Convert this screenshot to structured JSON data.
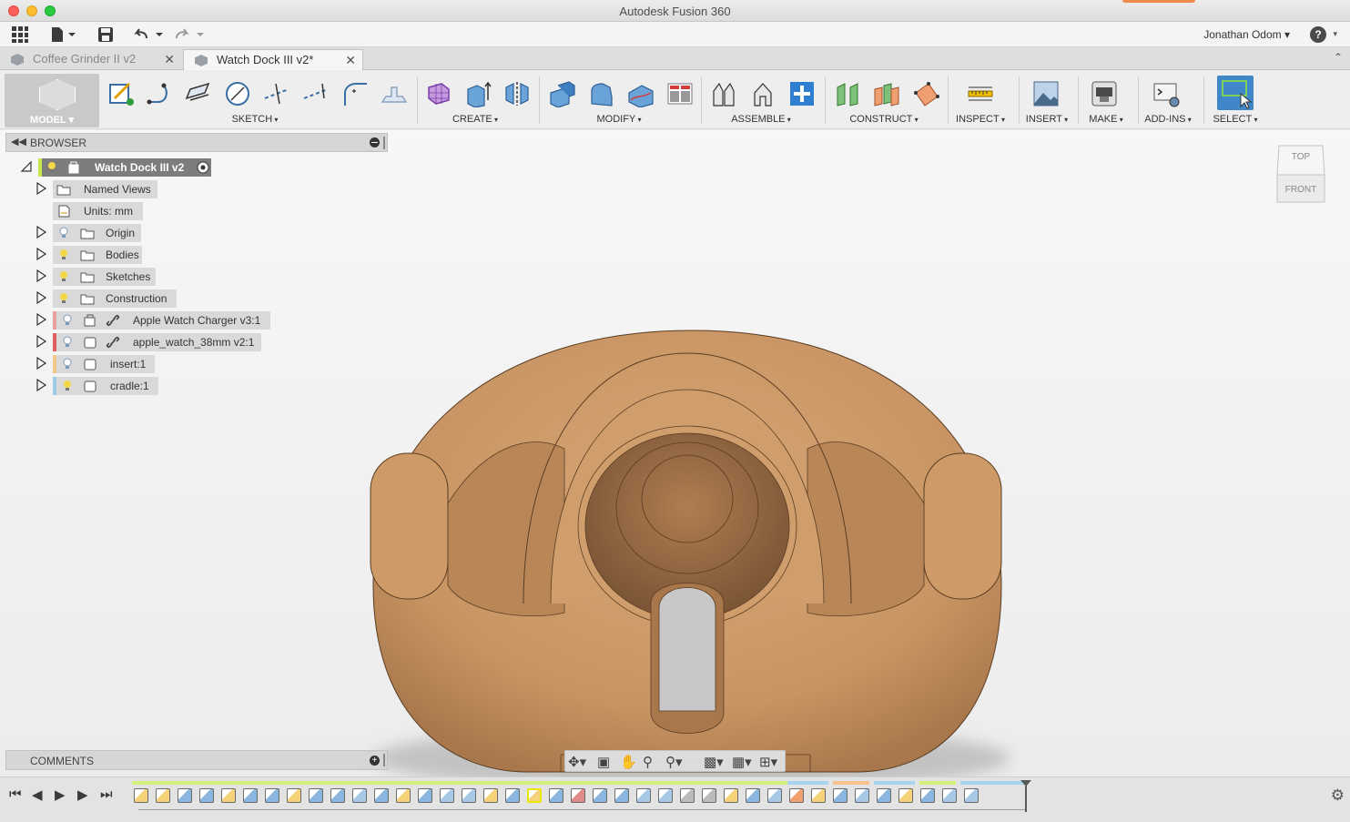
{
  "window": {
    "title": "Autodesk Fusion 360"
  },
  "appbar": {
    "user_name": "Jonathan Odom",
    "help_label": "?"
  },
  "tabs": [
    {
      "label": "Coffee Grinder II v2",
      "active": false
    },
    {
      "label": "Watch Dock III v2*",
      "active": true
    }
  ],
  "toolbar": {
    "workspace": "MODEL",
    "groups": [
      "SKETCH",
      "CREATE",
      "MODIFY",
      "ASSEMBLE",
      "CONSTRUCT",
      "INSPECT",
      "INSERT",
      "MAKE",
      "ADD-INS",
      "SELECT"
    ]
  },
  "browser": {
    "title": "BROWSER",
    "root": "Watch Dock III v2",
    "items": [
      {
        "label": "Named Views",
        "icon": "folder-icon"
      },
      {
        "label": "Units: mm",
        "icon": "document-icon"
      },
      {
        "label": "Origin",
        "icon": "folder-icon"
      },
      {
        "label": "Bodies",
        "icon": "folder-icon"
      },
      {
        "label": "Sketches",
        "icon": "folder-icon"
      },
      {
        "label": "Construction",
        "icon": "folder-icon"
      },
      {
        "label": "Apple Watch Charger v3:1",
        "icon": "component-icon",
        "color": "#e8a0a0"
      },
      {
        "label": "apple_watch_38mm v2:1",
        "icon": "component-icon",
        "color": "#e06060"
      },
      {
        "label": "insert:1",
        "icon": "component-icon",
        "color": "#f3c68a"
      },
      {
        "label": "cradle:1",
        "icon": "component-icon",
        "color": "#9ecbe8"
      }
    ]
  },
  "viewcube": {
    "top": "TOP",
    "front": "FRONT"
  },
  "comments": {
    "title": "COMMENTS"
  },
  "colors": {
    "accent": "#3f87c8",
    "model": "#c89463",
    "selection_highlight": "#e8e800"
  }
}
